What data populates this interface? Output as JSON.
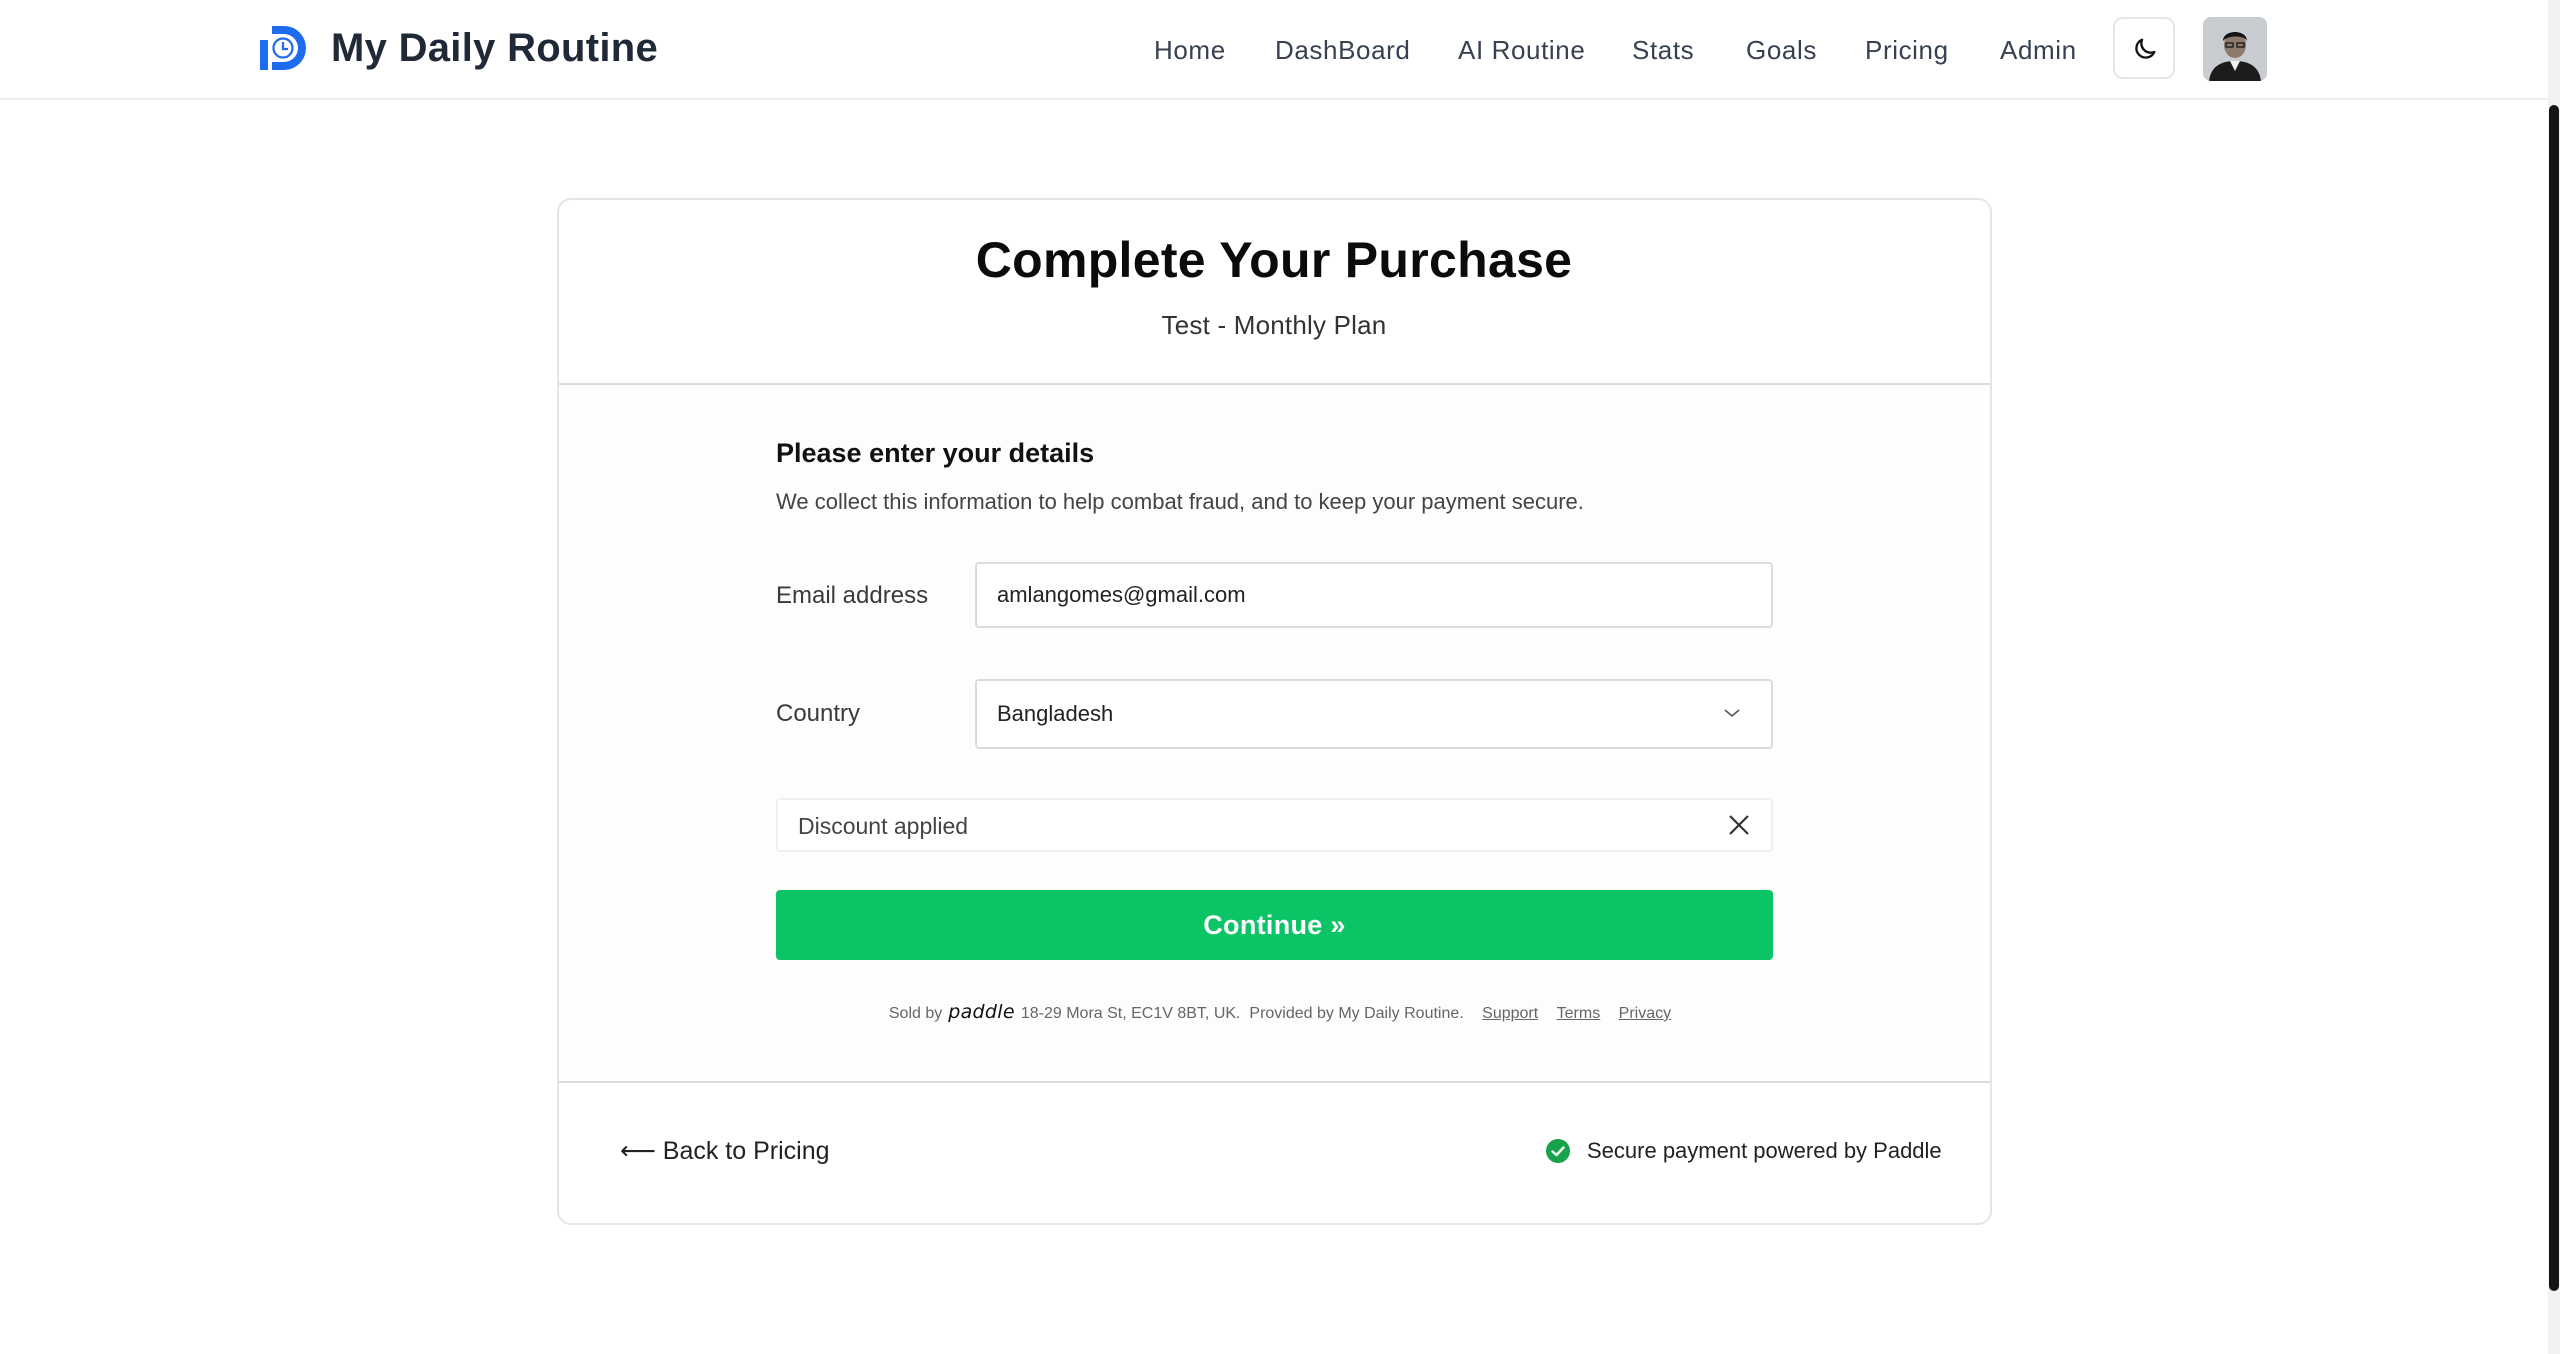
{
  "header": {
    "brand": "My Daily Routine",
    "nav": [
      "Home",
      "DashBoard",
      "AI Routine",
      "Stats",
      "Goals",
      "Pricing",
      "Admin"
    ],
    "brand_color": "#1e6bf0"
  },
  "card": {
    "title": "Complete Your Purchase",
    "subtitle": "Test - Monthly Plan"
  },
  "checkout": {
    "heading": "Please enter your details",
    "description": "We collect this information to help combat fraud, and to keep your payment secure.",
    "email_label": "Email address",
    "email_value": "amlangomes@gmail.com",
    "country_label": "Country",
    "country_value": "Bangladesh",
    "discount_text": "Discount applied",
    "continue_label": "Continue »",
    "continue_color": "#0ac466",
    "footer": {
      "sold_by": "Sold by",
      "paddle": "paddle",
      "address": "18-29 Mora St, EC1V 8BT, UK.",
      "provided_by": "Provided by  My Daily Routine.",
      "support": "Support",
      "terms": "Terms",
      "privacy": "Privacy"
    }
  },
  "bottom": {
    "back_link": "⟵ Back to Pricing",
    "secure_text": "Secure payment powered by Paddle",
    "secure_color": "#16a34a"
  }
}
